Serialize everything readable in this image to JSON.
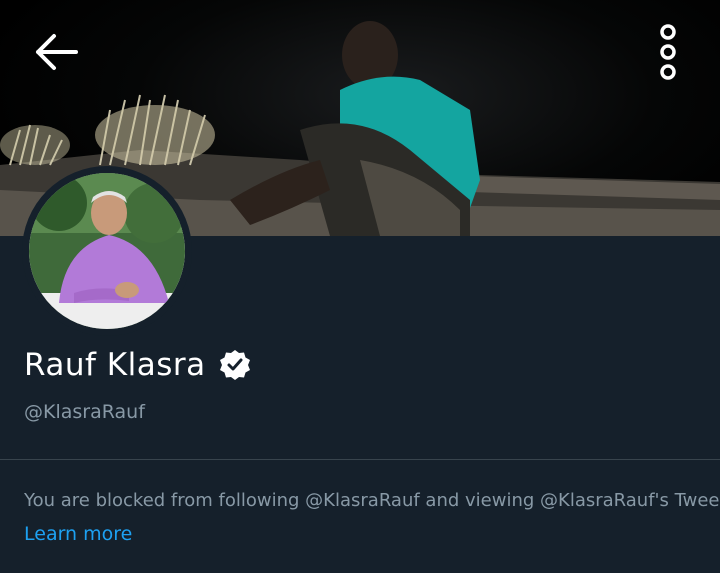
{
  "header": {
    "back_icon": "arrow-left-icon",
    "menu_icon": "more-vertical-icon"
  },
  "profile": {
    "display_name": "Rauf Klasra",
    "verified_icon": "verified-badge-icon",
    "handle": "@KlasraRauf"
  },
  "notice": {
    "message": "You are blocked from following @KlasraRauf and viewing @KlasraRauf's Tweets.",
    "learn_more": "Learn more"
  },
  "colors": {
    "background": "#15202b",
    "secondary_text": "#8899a6",
    "link": "#1da1f2",
    "divider": "#38444d"
  }
}
